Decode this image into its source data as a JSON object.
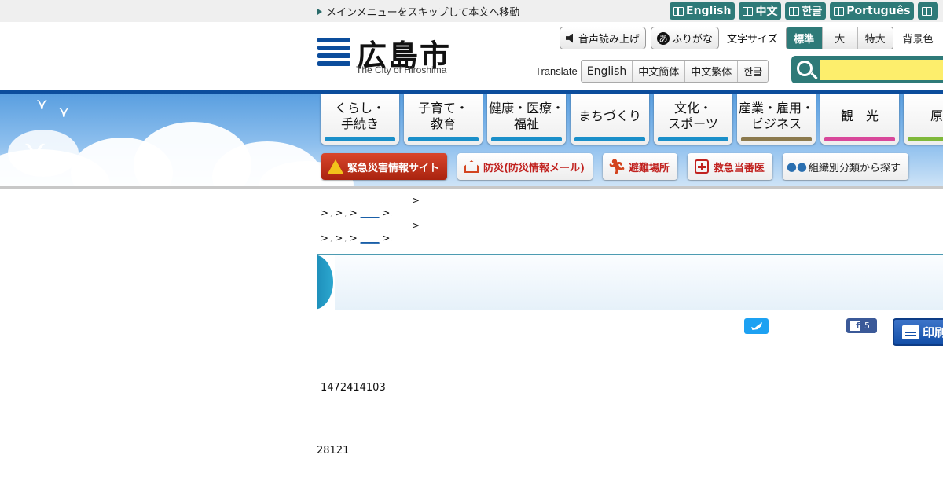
{
  "topbar": {
    "skip_link": "メインメニューをスキップして本文へ移動",
    "languages": [
      "English",
      "中文",
      "한글",
      "Português",
      ""
    ]
  },
  "header": {
    "logo_title": "広島市",
    "logo_subtitle": "The City of Hiroshima",
    "tools": {
      "voice": "音声読み上げ",
      "furigana": "ふりがな",
      "font_size_label": "文字サイズ",
      "font_sizes": [
        "標準",
        "大",
        "特大"
      ],
      "background_label": "背景色"
    },
    "translate": {
      "label": "Translate",
      "options": [
        "English",
        "中文簡体",
        "中文繁体",
        "한글"
      ]
    },
    "search": {
      "placeholder": ""
    }
  },
  "nav": {
    "items": [
      {
        "label": "くらし・\n手続き",
        "color": "#1a8fc9"
      },
      {
        "label": "子育て・\n教育",
        "color": "#1a8fc9"
      },
      {
        "label": "健康・医療・\n福祉",
        "color": "#1a8fc9"
      },
      {
        "label": "まちづくり",
        "color": "#1a8fc9"
      },
      {
        "label": "文化・\nスポーツ",
        "color": "#1a8fc9"
      },
      {
        "label": "産業・雇用・\nビジネス",
        "color": "#8c7a4e"
      },
      {
        "label": "観　光",
        "color": "#d8479a"
      },
      {
        "label": "原爆",
        "color": "#7fb83a"
      }
    ]
  },
  "quick_links": {
    "emergency": "緊急災害情報サイト",
    "disaster": "防災(防災情報メール)",
    "evacuation": "避難場所",
    "emergency_doctor": "救急当番医",
    "org": "組織別分類から探す"
  },
  "breadcrumbs": [
    {
      "links": [
        ">",
        ">",
        ">",
        "____",
        ">"
      ],
      "tail": ">"
    },
    {
      "links": [
        ">",
        ">",
        ">",
        "____",
        ">"
      ],
      "tail": ">"
    }
  ],
  "social": {
    "facebook_count": "5",
    "print_label": "印刷"
  },
  "content": {
    "number1": "1472414103",
    "number2": "28121"
  }
}
